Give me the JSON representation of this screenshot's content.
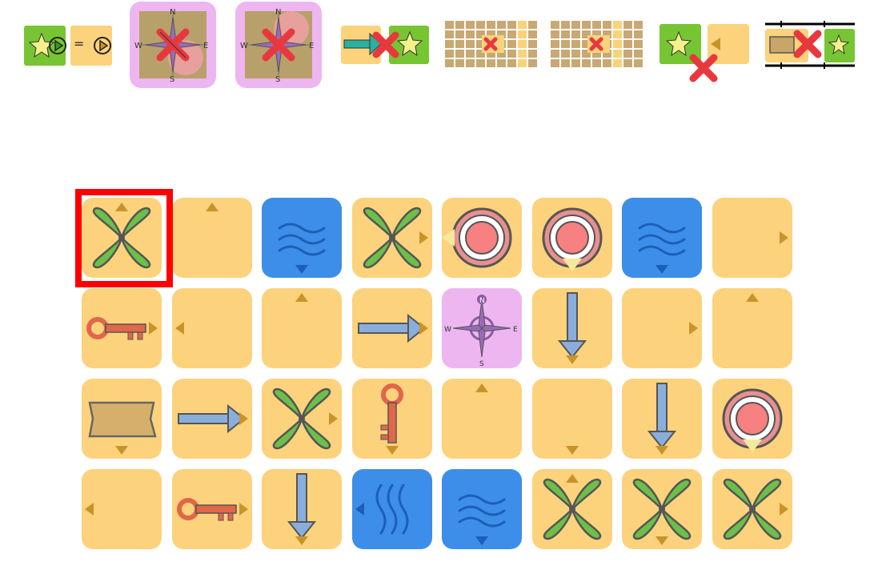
{
  "rules_bar": {
    "equals_sign": "=",
    "compass_letters": {
      "n": "N",
      "s": "S",
      "e": "E",
      "w": "W"
    }
  },
  "board": {
    "rows": 4,
    "cols": 8,
    "selected_cell": {
      "row": 0,
      "col": 0
    },
    "cells": [
      [
        {
          "type": "plant",
          "pointer": "up"
        },
        {
          "type": "empty",
          "pointer": "up"
        },
        {
          "type": "water-horizontal",
          "pointer": "down"
        },
        {
          "type": "plant",
          "pointer": "right"
        },
        {
          "type": "target",
          "pointer": "left-ghost"
        },
        {
          "type": "target",
          "pointer": "down-ghost"
        },
        {
          "type": "water-horizontal",
          "pointer": "down"
        },
        {
          "type": "empty",
          "pointer": "right"
        }
      ],
      [
        {
          "type": "key-horizontal",
          "pointer": "right"
        },
        {
          "type": "empty",
          "pointer": "left"
        },
        {
          "type": "empty",
          "pointer": "up"
        },
        {
          "type": "arrow-right",
          "pointer": "right"
        },
        {
          "type": "compass",
          "pointer": "none"
        },
        {
          "type": "arrow-down",
          "pointer": "down"
        },
        {
          "type": "empty",
          "pointer": "right"
        },
        {
          "type": "empty",
          "pointer": "up"
        }
      ],
      [
        {
          "type": "map",
          "pointer": "down"
        },
        {
          "type": "arrow-right",
          "pointer": "right"
        },
        {
          "type": "plant",
          "pointer": "right"
        },
        {
          "type": "key-vertical",
          "pointer": "down"
        },
        {
          "type": "empty",
          "pointer": "up"
        },
        {
          "type": "empty",
          "pointer": "down"
        },
        {
          "type": "arrow-down",
          "pointer": "down"
        },
        {
          "type": "target",
          "pointer": "down-ghost"
        }
      ],
      [
        {
          "type": "empty",
          "pointer": "left"
        },
        {
          "type": "key-horizontal",
          "pointer": "right"
        },
        {
          "type": "arrow-down",
          "pointer": "down"
        },
        {
          "type": "water-vertical",
          "pointer": "left"
        },
        {
          "type": "water-horizontal",
          "pointer": "down"
        },
        {
          "type": "plant",
          "pointer": "up"
        },
        {
          "type": "plant",
          "pointer": "down"
        },
        {
          "type": "plant",
          "pointer": "right"
        }
      ]
    ]
  },
  "colors": {
    "tile": "#fcd27c",
    "water": "#3d8ee8",
    "compass_bg": "#edb6f0",
    "selection": "#ff0000",
    "plant": "#6cc04a",
    "star_bg": "#77c532",
    "forbidden": "#e8383d"
  }
}
